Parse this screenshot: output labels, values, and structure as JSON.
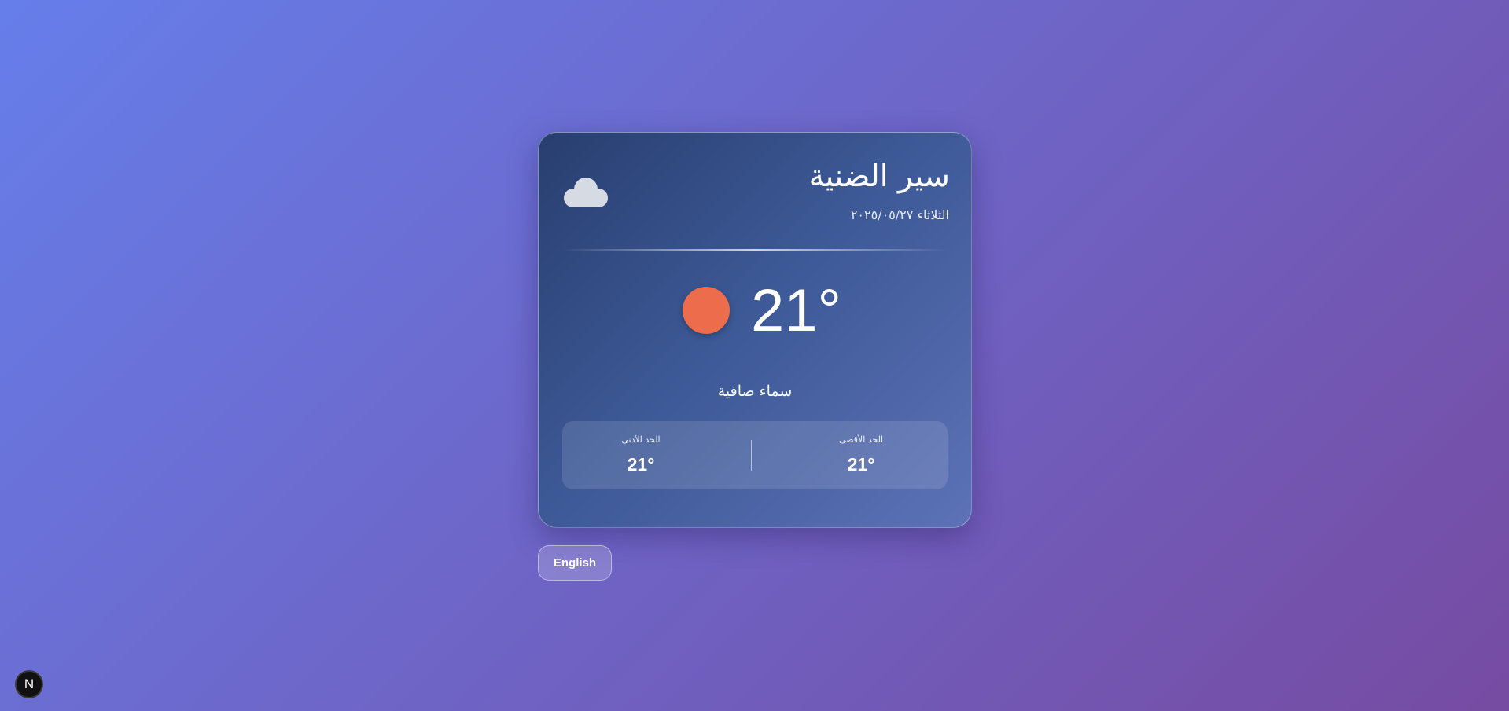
{
  "weather": {
    "city": "سير الضنية",
    "date": "الثلاثاء ٢٠٢٥/٠٥/٢٧",
    "header_icon": "cloud-icon",
    "current_icon": "sun-icon",
    "temperature": "21°",
    "condition": "سماء صافية",
    "max_label": "الحد الأقصى",
    "max_value": "21°",
    "min_label": "الحد الأدنى",
    "min_value": "21°"
  },
  "language_button": {
    "label": "English"
  },
  "dev_badge": {
    "label": "N",
    "icon": "nextjs-icon"
  },
  "colors": {
    "background_start": "#667eea",
    "background_end": "#764ba2",
    "sun": "#ec6c4b",
    "card_dark": "#283e6f",
    "card_light": "#5d72b7"
  }
}
